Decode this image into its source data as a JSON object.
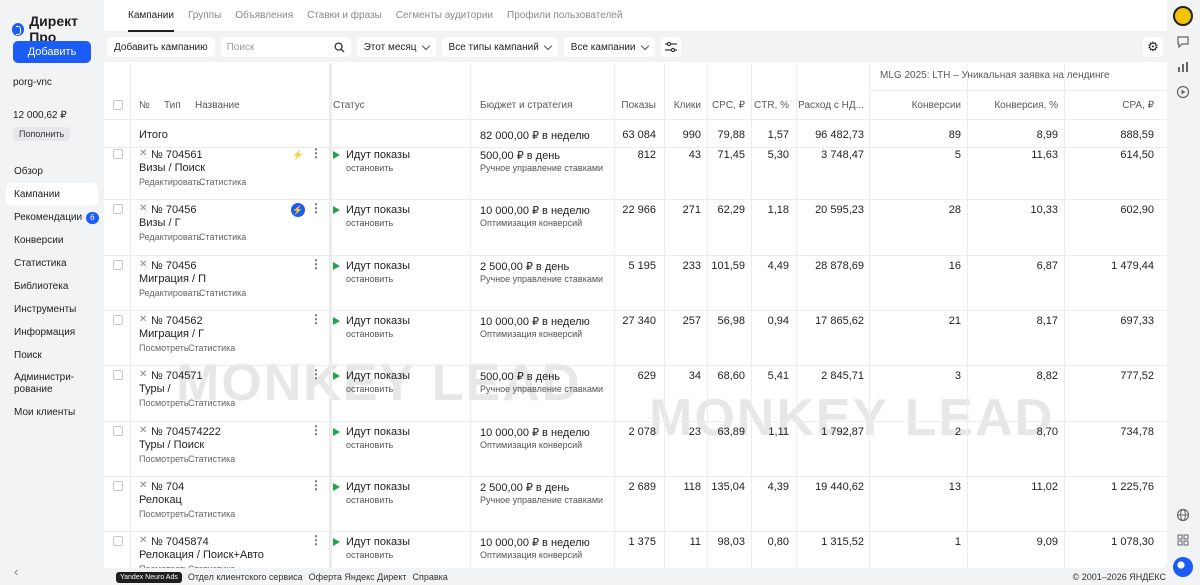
{
  "app": {
    "logo": "Директ Про",
    "add_label": "Добавить",
    "account": "porg-vnc",
    "balance": "12 000,62 ₽",
    "topup_label": "Пополнить"
  },
  "sidebar": [
    {
      "label": "Обзор"
    },
    {
      "label": "Кампании",
      "active": true
    },
    {
      "label": "Рекомендации",
      "badge": "6"
    },
    {
      "label": "Конверсии"
    },
    {
      "label": "Статистика"
    },
    {
      "label": "Библиотека"
    },
    {
      "label": "Инструменты"
    },
    {
      "label": "Информация"
    },
    {
      "label": "Поиск"
    },
    {
      "label": "Администри-рование"
    },
    {
      "label": "Мои клиенты"
    }
  ],
  "tabs": [
    "Кампании",
    "Группы",
    "Объявления",
    "Ставки и фразы",
    "Сегменты аудитории",
    "Профили пользователей"
  ],
  "toolbar": {
    "add_campaign": "Добавить кампанию",
    "search_placeholder": "Поиск",
    "period": "Этот месяц",
    "types": "Все типы кампаний",
    "campaigns": "Все кампании"
  },
  "table": {
    "group_header": "MLG 2025: LTH – Уникальная заявка на лендинге",
    "headers": {
      "no": "№",
      "type": "Тип",
      "name": "Название",
      "status": "Статус",
      "budget": "Бюджет и стратегия",
      "shows": "Показы",
      "clicks": "Клики",
      "cpc": "CPC, ₽",
      "ctr": "CTR, %",
      "spend": "Расход с НД...",
      "conv": "Конверсии",
      "conv_rate": "Конверсия, %",
      "cpa": "CPA, ₽"
    },
    "total": {
      "label": "Итого",
      "budget": "82 000,00 ₽ в неделю",
      "shows": "63 084",
      "clicks": "990",
      "cpc": "79,88",
      "ctr": "1,57",
      "spend": "96 482,73",
      "conv": "89",
      "conv_rate": "8,99",
      "cpa": "888,59"
    },
    "rows": [
      {
        "id": "№ 704561",
        "name": "Визы / Поиск",
        "links": [
          "Редактировать",
          "Статистика"
        ],
        "icon": "bolt",
        "status": "Идут показы",
        "action": "остановить",
        "budget": "500,00 ₽ в день",
        "strategy": "Ручное управление ставками",
        "shows": "812",
        "clicks": "43",
        "cpc": "71,45",
        "ctr": "5,30",
        "spend": "3 748,47",
        "conv": "5",
        "conv_rate": "11,63",
        "cpa": "614,50"
      },
      {
        "id": "№ 70456",
        "name": "Визы / Г",
        "links": [
          "Редактировать",
          "Статистика"
        ],
        "icon": "bolt-blue",
        "status": "Идут показы",
        "action": "остановить",
        "budget": "10 000,00 ₽ в неделю",
        "strategy": "Оптимизация конверсий",
        "shows": "22 966",
        "clicks": "271",
        "cpc": "62,29",
        "ctr": "1,18",
        "spend": "20 595,23",
        "conv": "28",
        "conv_rate": "10,33",
        "cpa": "602,90"
      },
      {
        "id": "№ 70456",
        "name": "Миграция / П",
        "links": [
          "Редактировать",
          "Статистика"
        ],
        "icon": "",
        "status": "Идут показы",
        "action": "остановить",
        "budget": "2 500,00 ₽ в день",
        "strategy": "Ручное управление ставками",
        "shows": "5 195",
        "clicks": "233",
        "cpc": "101,59",
        "ctr": "4,49",
        "spend": "28 878,69",
        "conv": "16",
        "conv_rate": "6,87",
        "cpa": "1 479,44"
      },
      {
        "id": "№ 704562",
        "name": "Миграция / Г",
        "links": [
          "Посмотреть",
          "Статистика"
        ],
        "icon": "",
        "status": "Идут показы",
        "action": "остановить",
        "budget": "10 000,00 ₽ в неделю",
        "strategy": "Оптимизация конверсий",
        "shows": "27 340",
        "clicks": "257",
        "cpc": "56,98",
        "ctr": "0,94",
        "spend": "17 865,62",
        "conv": "21",
        "conv_rate": "8,17",
        "cpa": "697,33"
      },
      {
        "id": "№ 704571",
        "name": "Туры /",
        "links": [
          "Посмотреть",
          "Статистика"
        ],
        "icon": "",
        "status": "Идут показы",
        "action": "остановить",
        "budget": "500,00 ₽ в день",
        "strategy": "Ручное управление ставками",
        "shows": "629",
        "clicks": "34",
        "cpc": "68,60",
        "ctr": "5,41",
        "spend": "2 845,71",
        "conv": "3",
        "conv_rate": "8,82",
        "cpa": "777,52"
      },
      {
        "id": "№ 704574222",
        "name": "Туры / Поиск",
        "links": [
          "Посмотреть",
          "Статистика"
        ],
        "icon": "",
        "status": "Идут показы",
        "action": "остановить",
        "budget": "10 000,00 ₽ в неделю",
        "strategy": "Оптимизация конверсий",
        "shows": "2 078",
        "clicks": "23",
        "cpc": "63,89",
        "ctr": "1,11",
        "spend": "1 792,87",
        "conv": "2",
        "conv_rate": "8,70",
        "cpa": "734,78"
      },
      {
        "id": "№ 704",
        "name": "Релокац",
        "links": [
          "Посмотреть",
          "Статистика"
        ],
        "icon": "",
        "status": "Идут показы",
        "action": "остановить",
        "budget": "2 500,00 ₽ в день",
        "strategy": "Ручное управление ставками",
        "shows": "2 689",
        "clicks": "118",
        "cpc": "135,04",
        "ctr": "4,39",
        "spend": "19 440,62",
        "conv": "13",
        "conv_rate": "11,02",
        "cpa": "1 225,76"
      },
      {
        "id": "№ 7045874",
        "name": "Релокация / Поиск+Авто",
        "links": [
          "Посмотреть",
          "Статистика"
        ],
        "icon": "",
        "status": "Идут показы",
        "action": "остановить",
        "budget": "10 000,00 ₽ в неделю",
        "strategy": "Оптимизация конверсий",
        "shows": "1 375",
        "clicks": "11",
        "cpc": "98,03",
        "ctr": "0,80",
        "spend": "1 315,52",
        "conv": "1",
        "conv_rate": "9,09",
        "cpa": "1 078,30"
      }
    ]
  },
  "watermark": "MONKEY LEAD",
  "footer": {
    "neuro": "Yandex Neuro Ads",
    "links": [
      "Отдел клиентского сервиса",
      "Оферта Яндекс Директ",
      "Справка"
    ],
    "copyright": "© 2001–2026 ЯНДЕКС"
  }
}
